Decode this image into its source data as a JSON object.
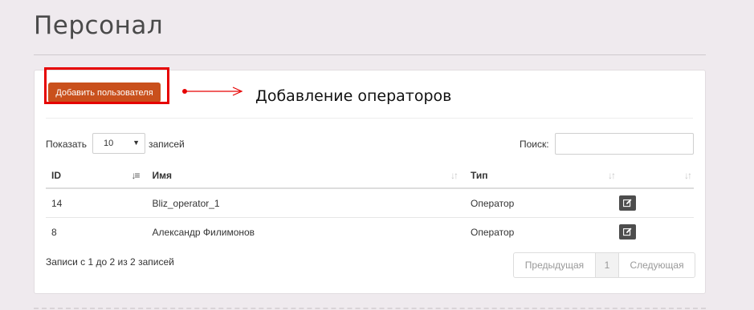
{
  "page": {
    "title": "Персонал"
  },
  "toolbar": {
    "add_user_label": "Добавить пользователя"
  },
  "annotation": {
    "text": "Добавление операторов",
    "color": "#e60000"
  },
  "table_controls": {
    "show_label": "Показать",
    "length_value": "10",
    "records_label": "записей",
    "search_label": "Поиск:",
    "search_value": ""
  },
  "table": {
    "columns": [
      "ID",
      "Имя",
      "Тип",
      ""
    ],
    "rows": [
      {
        "id": "14",
        "name": "Bliz_operator_1",
        "type": "Оператор"
      },
      {
        "id": "8",
        "name": "Александр Филимонов",
        "type": "Оператор"
      }
    ]
  },
  "footer": {
    "info": "Записи с 1 до 2 из 2 записей",
    "prev": "Предыдущая",
    "page": "1",
    "next": "Следующая"
  },
  "colors": {
    "accent": "#c9501c",
    "background": "#efeaee"
  }
}
